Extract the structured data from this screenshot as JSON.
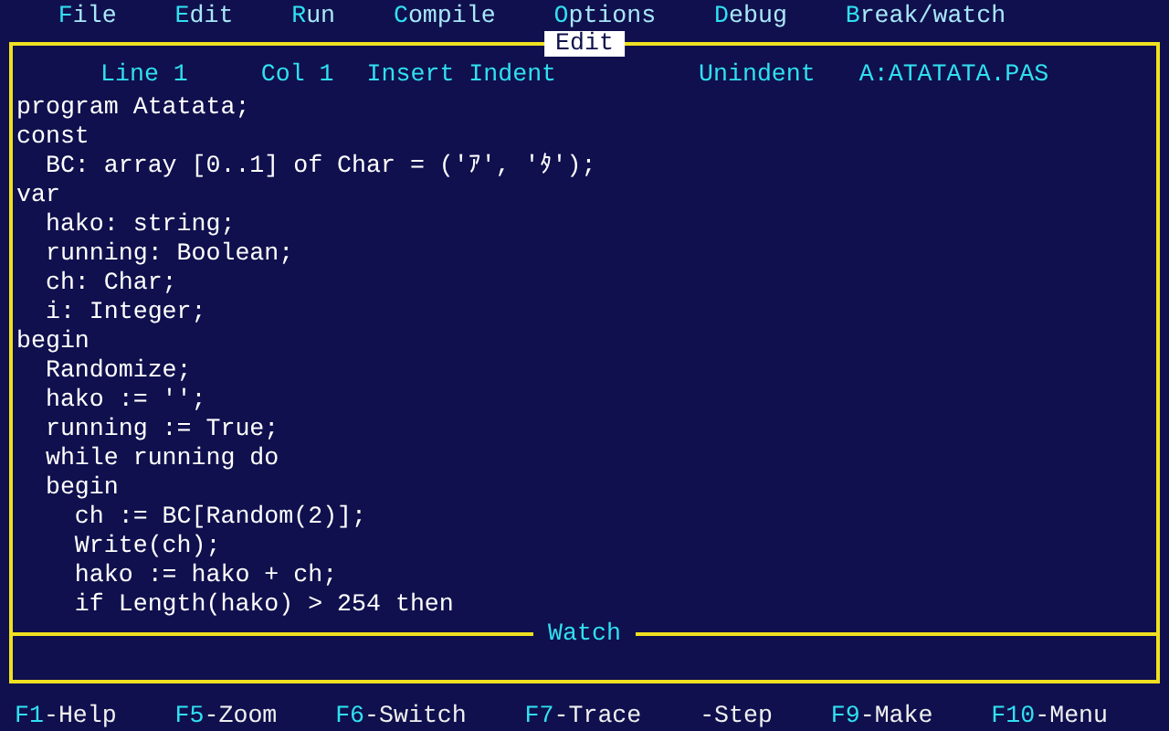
{
  "menu": [
    {
      "key": "F",
      "rest": "ile"
    },
    {
      "key": "E",
      "rest": "dit"
    },
    {
      "key": "R",
      "rest": "un"
    },
    {
      "key": "C",
      "rest": "ompile"
    },
    {
      "key": "O",
      "rest": "ptions"
    },
    {
      "key": "D",
      "rest": "ebug"
    },
    {
      "key": "B",
      "rest": "reak/watch"
    }
  ],
  "editor": {
    "title": "Edit",
    "status": [
      "Line 1",
      "Col 1",
      "Insert Indent",
      "Unindent",
      "A:ATATATA.PAS"
    ],
    "lines": [
      "program Atatata;",
      "const",
      "  BC: array [0..1] of Char = ('ｱ', 'ﾀ');",
      "var",
      "  hako: string;",
      "  running: Boolean;",
      "  ch: Char;",
      "  i: Integer;",
      "begin",
      "  Randomize;",
      "  hako := '';",
      "  running := True;",
      "  while running do",
      "  begin",
      "    ch := BC[Random(2)];",
      "    Write(ch);",
      "    hako := hako + ch;",
      "    if Length(hako) > 254 then"
    ]
  },
  "watch": {
    "title": "Watch"
  },
  "footer": [
    {
      "key": "F1",
      "label": "-Help"
    },
    {
      "key": "F5",
      "label": "-Zoom"
    },
    {
      "key": "F6",
      "label": "-Switch"
    },
    {
      "key": "F7",
      "label": "-Trace"
    },
    {
      "label": "-Step"
    },
    {
      "key": "F9",
      "label": "-Make"
    },
    {
      "key": "F10",
      "label": "-Menu"
    }
  ]
}
